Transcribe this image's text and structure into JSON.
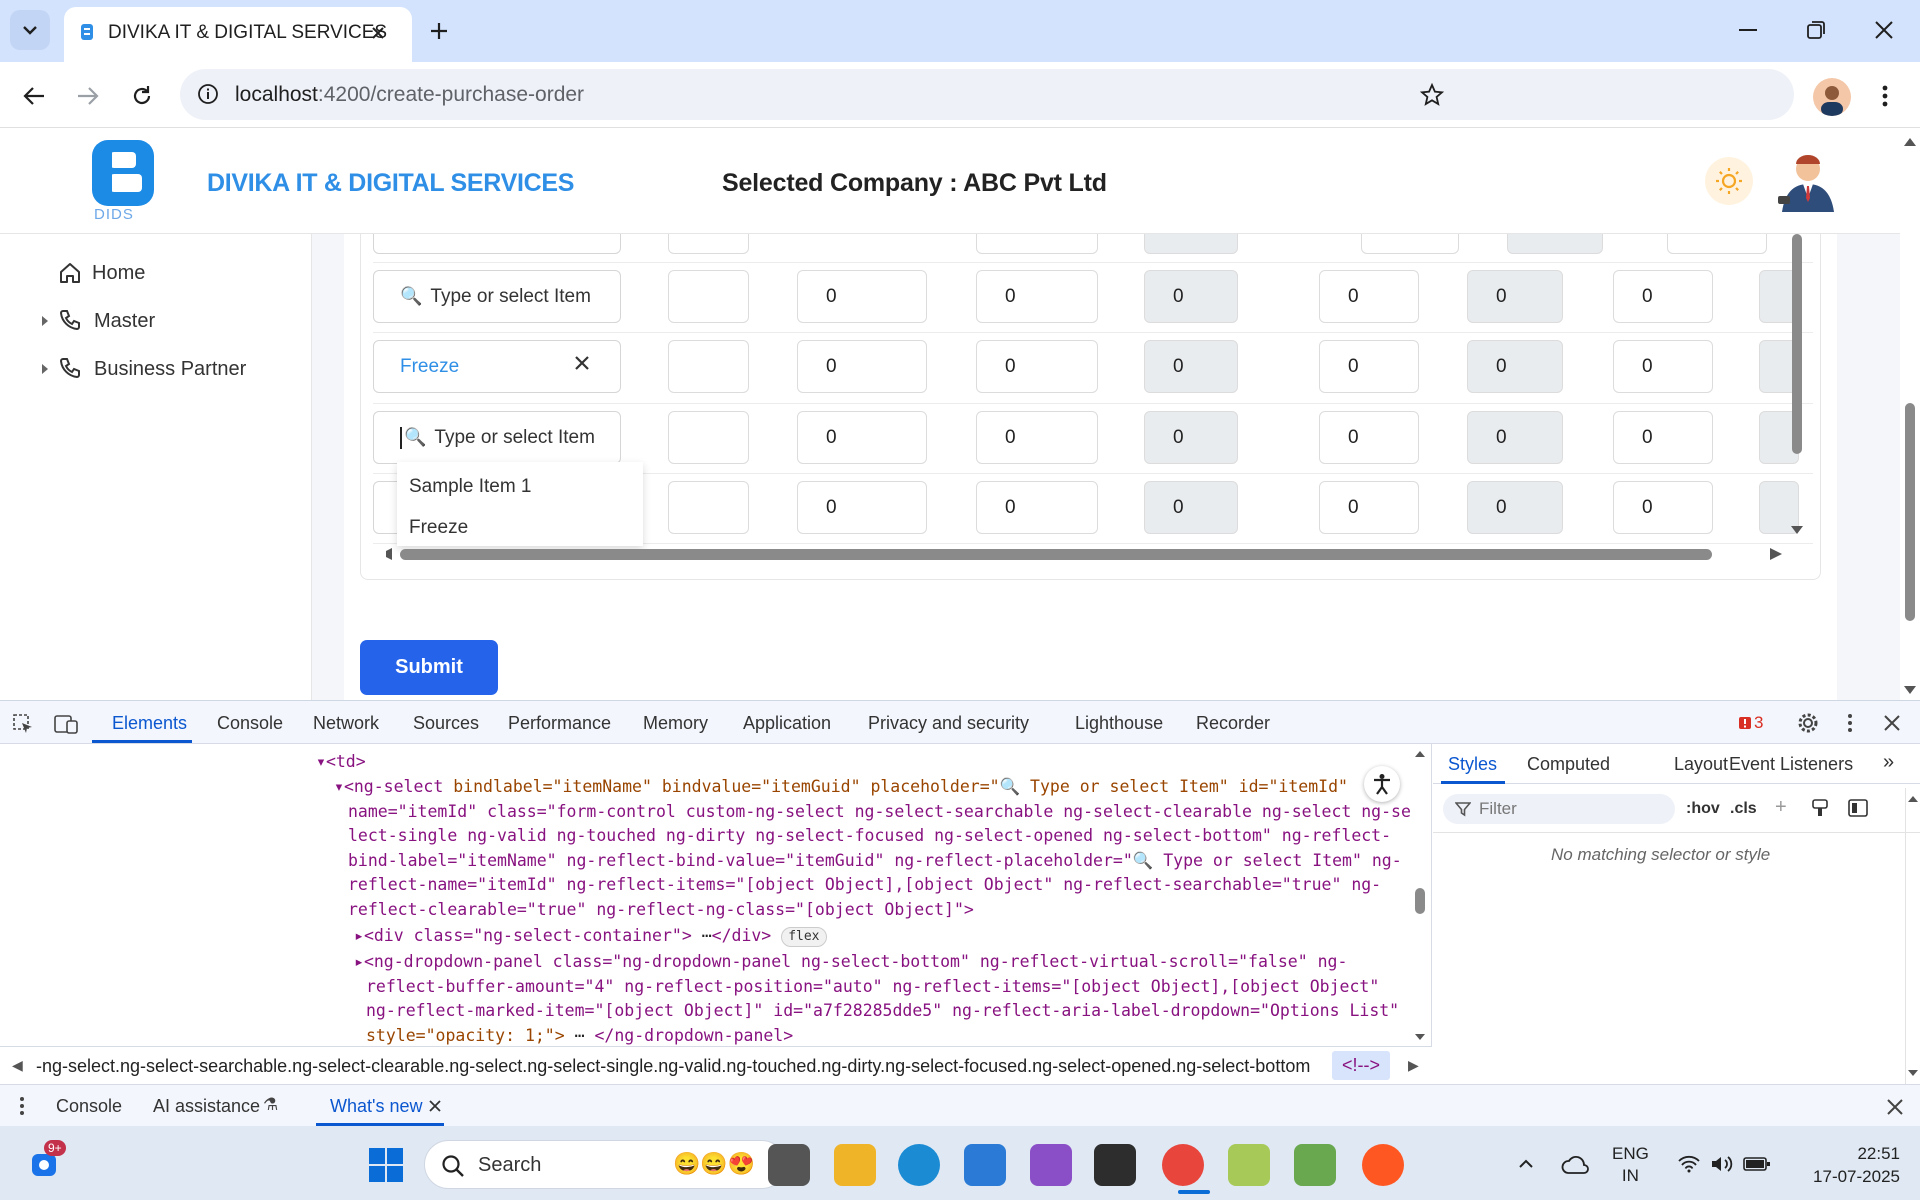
{
  "browser": {
    "tab_title": "DIVIKA IT & DIGITAL SERVICES",
    "url_host": "localhost",
    "url_path": ":4200/create-purchase-order"
  },
  "app": {
    "brand_name": "DIVIKA IT & DIGITAL SERVICES",
    "logo_text": "DIDS",
    "selected_company": "Selected Company : ABC Pvt Ltd",
    "colors": {
      "brand": "#2f8fe6",
      "primary_button": "#2563eb"
    }
  },
  "sidebar": {
    "items": [
      {
        "label": "Home",
        "icon": "home-icon"
      },
      {
        "label": "Master",
        "icon": "phone-icon"
      },
      {
        "label": "Business Partner",
        "icon": "phone-icon"
      }
    ]
  },
  "table": {
    "placeholder": "Type or select Item",
    "rows": [
      {
        "item": "Type or select Item",
        "is_placeholder": true,
        "values": [
          "0",
          "0",
          "0",
          "0",
          "0",
          "0"
        ]
      },
      {
        "item": "Freeze",
        "is_placeholder": false,
        "values": [
          "0",
          "0",
          "0",
          "0",
          "0",
          "0"
        ]
      },
      {
        "item": "Type or select Item",
        "is_placeholder": true,
        "values": [
          "0",
          "0",
          "0",
          "0",
          "0",
          "0"
        ]
      },
      {
        "item": "",
        "is_placeholder": false,
        "values": [
          "0",
          "0",
          "0",
          "0",
          "0",
          "0"
        ]
      }
    ],
    "dropdown_options": [
      "Sample Item 1",
      "Freeze"
    ]
  },
  "submit_label": "Submit",
  "devtools": {
    "tabs": [
      "Elements",
      "Console",
      "Network",
      "Sources",
      "Performance",
      "Memory",
      "Application",
      "Privacy and security",
      "Lighthouse",
      "Recorder"
    ],
    "issues_count": "3",
    "code_lines": {
      "l1": "<td>",
      "l2a": "<ng-select ",
      "l2b": "bindlabel=\"itemName\" bindvalue=\"itemGuid\" placeholder=\"🔍 Type or select Item\" id=\"itemId\"",
      "l3": "name=\"itemId\" class=\"form-control custom-ng-select ng-select-searchable ng-select-clearable ng-select ng-se",
      "l4": "lect-single ng-valid ng-touched ng-dirty ng-select-focused ng-select-opened ng-select-bottom\" ng-reflect-",
      "l5": "bind-label=\"itemName\" ng-reflect-bind-value=\"itemGuid\" ng-reflect-placeholder=\"🔍 Type or select Item\" ng-",
      "l6": "reflect-name=\"itemId\" ng-reflect-items=\"[object Object],[object Object\" ng-reflect-searchable=\"true\" ng-",
      "l7": "reflect-clearable=\"true\" ng-reflect-ng-class=\"[object Object]\">",
      "l8": "<div class=\"ng-select-container\">",
      "l8b": "</div>",
      "l8badge": "flex",
      "l9": "<ng-dropdown-panel class=\"ng-dropdown-panel ng-select-bottom\" ng-reflect-virtual-scroll=\"false\" ng-",
      "l10": "reflect-buffer-amount=\"4\" ng-reflect-position=\"auto\" ng-reflect-items=\"[object Object],[object Object\"",
      "l11": "ng-reflect-marked-item=\"[object Object]\" id=\"a7f28285dde5\" ng-reflect-aria-label-dropdown=\"Options List\"",
      "l12a": "style=\"opacity: 1;\">",
      "l12b": "</ng-dropdown-panel>"
    },
    "breadcrumb": "-ng-select.ng-select-searchable.ng-select-clearable.ng-select.ng-select-single.ng-valid.ng-touched.ng-dirty.ng-select-focused.ng-select-opened.ng-select-bottom",
    "breadcrumb_end": "<!-->",
    "styles_tabs": [
      "Styles",
      "Computed",
      "Layout",
      "Event Listeners"
    ],
    "filter_placeholder": "Filter",
    "hov": ":hov",
    "cls": ".cls",
    "no_match": "No matching selector or style",
    "drawer_tabs": [
      "Console",
      "AI assistance",
      "What's new"
    ]
  },
  "taskbar": {
    "search_label": "Search",
    "lang1": "ENG",
    "lang2": "IN",
    "time": "22:51",
    "date": "17-07-2025",
    "notif_badge": "9+"
  }
}
